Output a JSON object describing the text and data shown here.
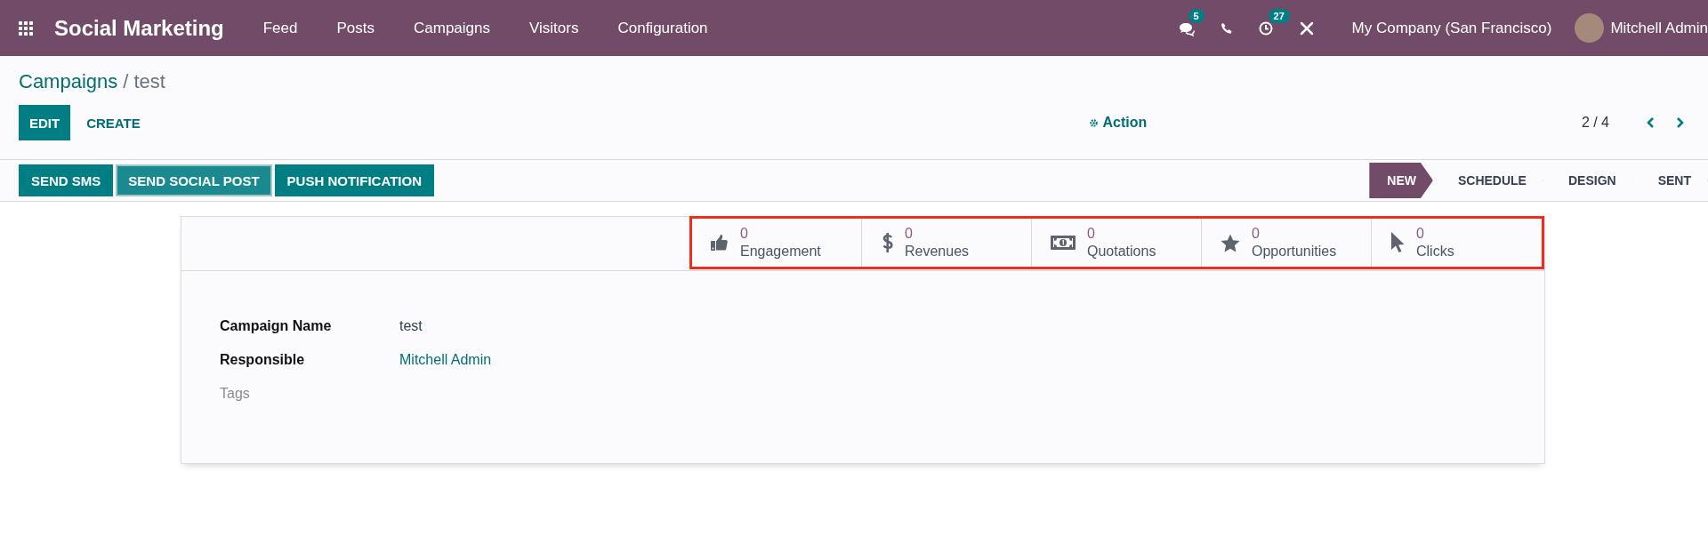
{
  "navbar": {
    "app_title": "Social Marketing",
    "menu": [
      "Feed",
      "Posts",
      "Campaigns",
      "Visitors",
      "Configuration"
    ],
    "messages_badge": "5",
    "activities_badge": "27",
    "company": "My Company (San Francisco)",
    "user": "Mitchell Admin"
  },
  "breadcrumb": {
    "parent": "Campaigns",
    "separator": "/",
    "current": "test"
  },
  "control_panel": {
    "buttons": [
      {
        "label": "EDIT",
        "kind": "primary"
      },
      {
        "label": "CREATE",
        "kind": "link"
      }
    ],
    "action": "Action",
    "pager": "2 / 4"
  },
  "header_buttons": [
    {
      "label": "SEND SMS",
      "focused": false
    },
    {
      "label": "SEND SOCIAL POST",
      "focused": true
    },
    {
      "label": "PUSH NOTIFICATION",
      "focused": false
    }
  ],
  "status_bar": [
    {
      "label": "NEW",
      "selected": true
    },
    {
      "label": "SCHEDULE",
      "selected": false
    },
    {
      "label": "DESIGN",
      "selected": false
    },
    {
      "label": "SENT",
      "selected": false
    }
  ],
  "smart_buttons_highlighted": true,
  "smart_buttons": [
    {
      "kind": "engagement",
      "value": "0",
      "label": "Engagement"
    },
    {
      "kind": "revenues",
      "value": "0",
      "label": "Revenues"
    },
    {
      "kind": "quotations",
      "value": "0",
      "label": "Quotations"
    },
    {
      "kind": "opportunities",
      "value": "0",
      "label": "Opportunities"
    },
    {
      "kind": "clicks",
      "value": "0",
      "label": "Clicks"
    }
  ],
  "fields": [
    {
      "label": "Campaign Name",
      "value": "test",
      "kind": "text"
    },
    {
      "label": "Responsible",
      "value": "Mitchell Admin",
      "kind": "link"
    },
    {
      "label": "Tags",
      "kind": "empty"
    }
  ]
}
